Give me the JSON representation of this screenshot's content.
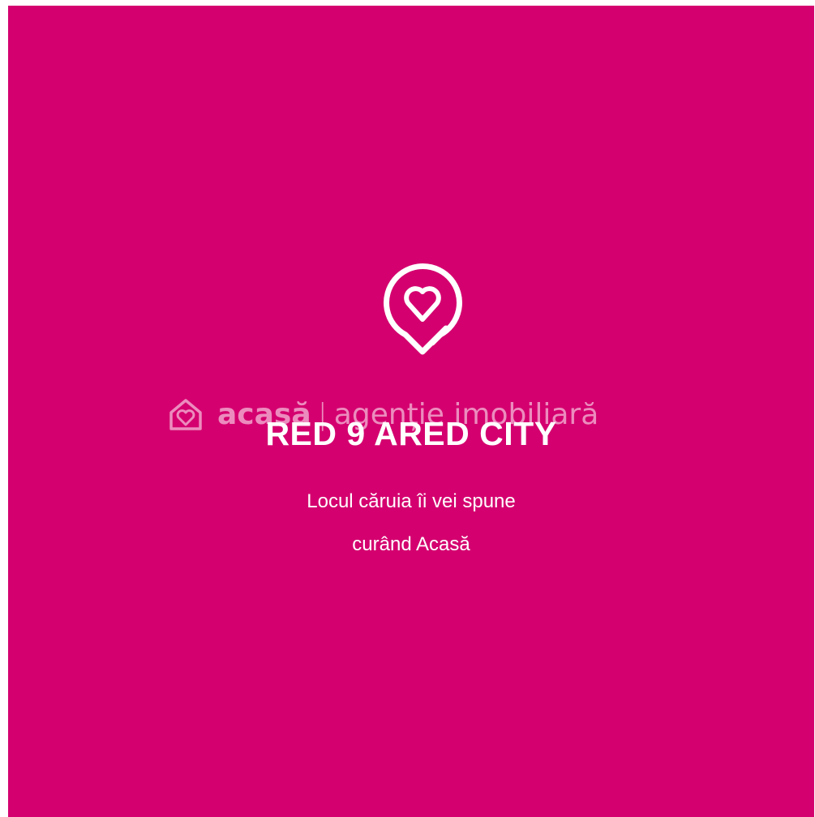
{
  "background_color": "#d4006f",
  "logo": {
    "icon": "heart-location-pin-icon"
  },
  "watermark": {
    "icon": "home-heart-icon",
    "brand": "acasă",
    "separator": "|",
    "subtitle": "agenție imobiliară"
  },
  "headline": "RED 9 ARED CITY",
  "tagline": {
    "line1": "Locul căruia îi vei spune",
    "line2": "curând Acasă"
  }
}
